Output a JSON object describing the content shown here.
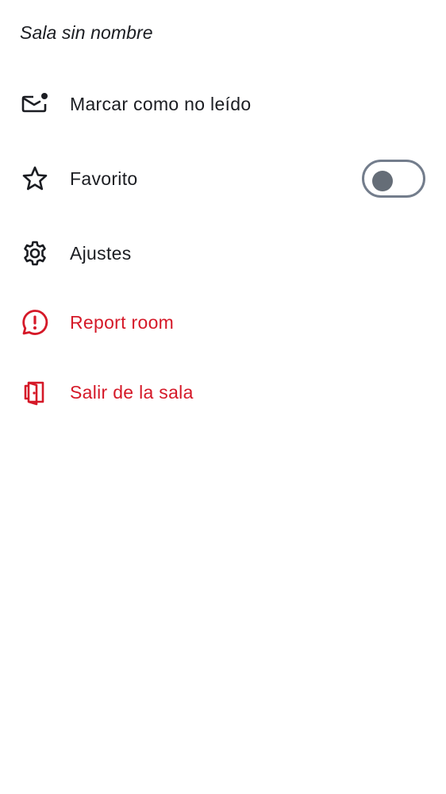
{
  "room": {
    "title": "Sala sin nombre"
  },
  "menu": {
    "items": [
      {
        "label": "Marcar como no leído",
        "icon": "mail-unread-icon"
      },
      {
        "label": "Favorito",
        "icon": "star-outline-icon",
        "toggle_on": false
      },
      {
        "label": "Ajustes",
        "icon": "gear-icon"
      },
      {
        "label": "Report room",
        "icon": "report-chat-icon"
      },
      {
        "label": "Salir de la sala",
        "icon": "leave-door-icon"
      }
    ]
  },
  "colors": {
    "text": "#1b1d22",
    "danger": "#d51928",
    "toggle_border": "#737d8c",
    "toggle_knob": "#656d77",
    "background": "#ffffff"
  }
}
